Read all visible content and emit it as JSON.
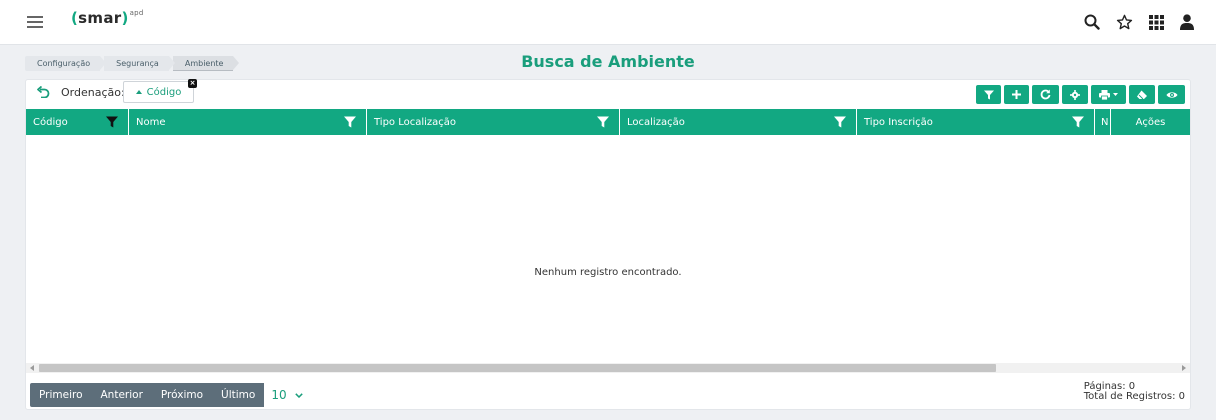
{
  "header": {
    "logo_text": "smar",
    "logo_sup": "apd",
    "icons": [
      "search-icon",
      "star-icon",
      "apps-grid-icon",
      "user-icon"
    ]
  },
  "breadcrumb": [
    "Configuração",
    "Segurança",
    "Ambiente"
  ],
  "page_title": "Busca de Ambiente",
  "ordering": {
    "label": "Ordenação:",
    "chip": "Código"
  },
  "toolbar": [
    "filter-icon",
    "plus-icon",
    "refresh-icon",
    "gear-icon",
    "print-icon",
    "eraser-icon",
    "eye-icon"
  ],
  "table": {
    "columns": [
      "Código",
      "Nome",
      "Tipo Localização",
      "Localização",
      "Tipo Inscrição",
      "N",
      "Ações"
    ],
    "empty_message": "Nenhum registro encontrado."
  },
  "pagination": {
    "buttons": [
      "Primeiro",
      "Anterior",
      "Próximo",
      "Último"
    ],
    "page_size": "10",
    "pages_text": "Páginas: 0",
    "total_text": "Total de Registros: 0"
  },
  "colors": {
    "accent": "#12a882",
    "title": "#1a9e7c",
    "pager": "#5d6e7a"
  }
}
